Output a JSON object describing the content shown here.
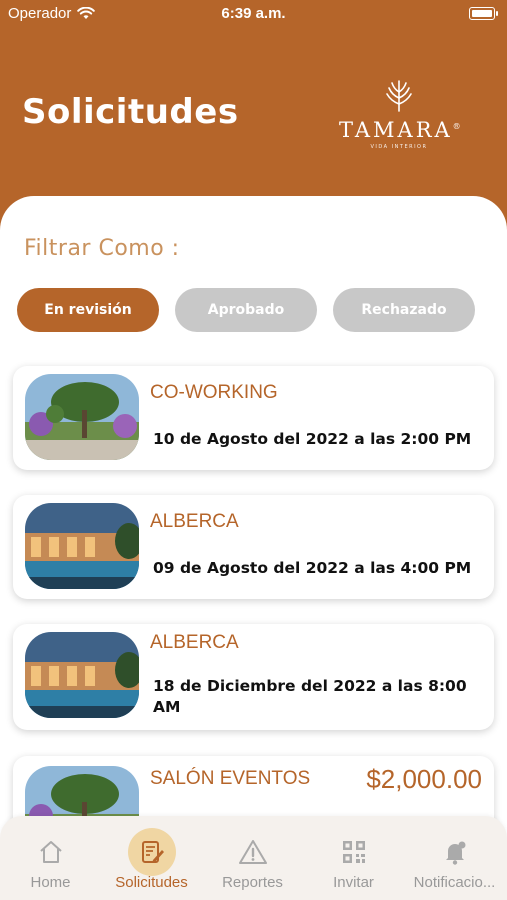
{
  "status_bar": {
    "carrier": "Operador",
    "time": "6:39 a.m."
  },
  "header": {
    "title": "Solicitudes",
    "logo": {
      "name": "TAMARA",
      "mark": "®",
      "tagline": "VIDA INTERIOR"
    }
  },
  "filter": {
    "label": "Filtrar Como :",
    "options": [
      {
        "label": "En revisión",
        "selected": true
      },
      {
        "label": "Aprobado",
        "selected": false
      },
      {
        "label": "Rechazado",
        "selected": false
      }
    ]
  },
  "requests": [
    {
      "title": "CO-WORKING",
      "date": "10 de Agosto del 2022 a las 2:00 PM",
      "image": "garden"
    },
    {
      "title": "ALBERCA",
      "date": "09 de Agosto del 2022 a las 4:00 PM",
      "image": "pool"
    },
    {
      "title": "ALBERCA",
      "date": "18 de Diciembre del 2022 a las 8:00 AM",
      "image": "pool"
    },
    {
      "title": "SALÓN EVENTOS",
      "price": "$2,000.00",
      "image": "garden"
    }
  ],
  "tabs": [
    {
      "label": "Home",
      "icon": "home-icon",
      "active": false
    },
    {
      "label": "Solicitudes",
      "icon": "document-edit-icon",
      "active": true
    },
    {
      "label": "Reportes",
      "icon": "warning-icon",
      "active": false
    },
    {
      "label": "Invitar",
      "icon": "qr-code-icon",
      "active": false
    },
    {
      "label": "Notificacio...",
      "icon": "bell-icon",
      "active": false
    }
  ],
  "colors": {
    "brand": "#b5652a",
    "chip_inactive": "#c8c8c8",
    "filter_label": "#c9925e",
    "tab_active_bg": "#f0d6a3"
  }
}
